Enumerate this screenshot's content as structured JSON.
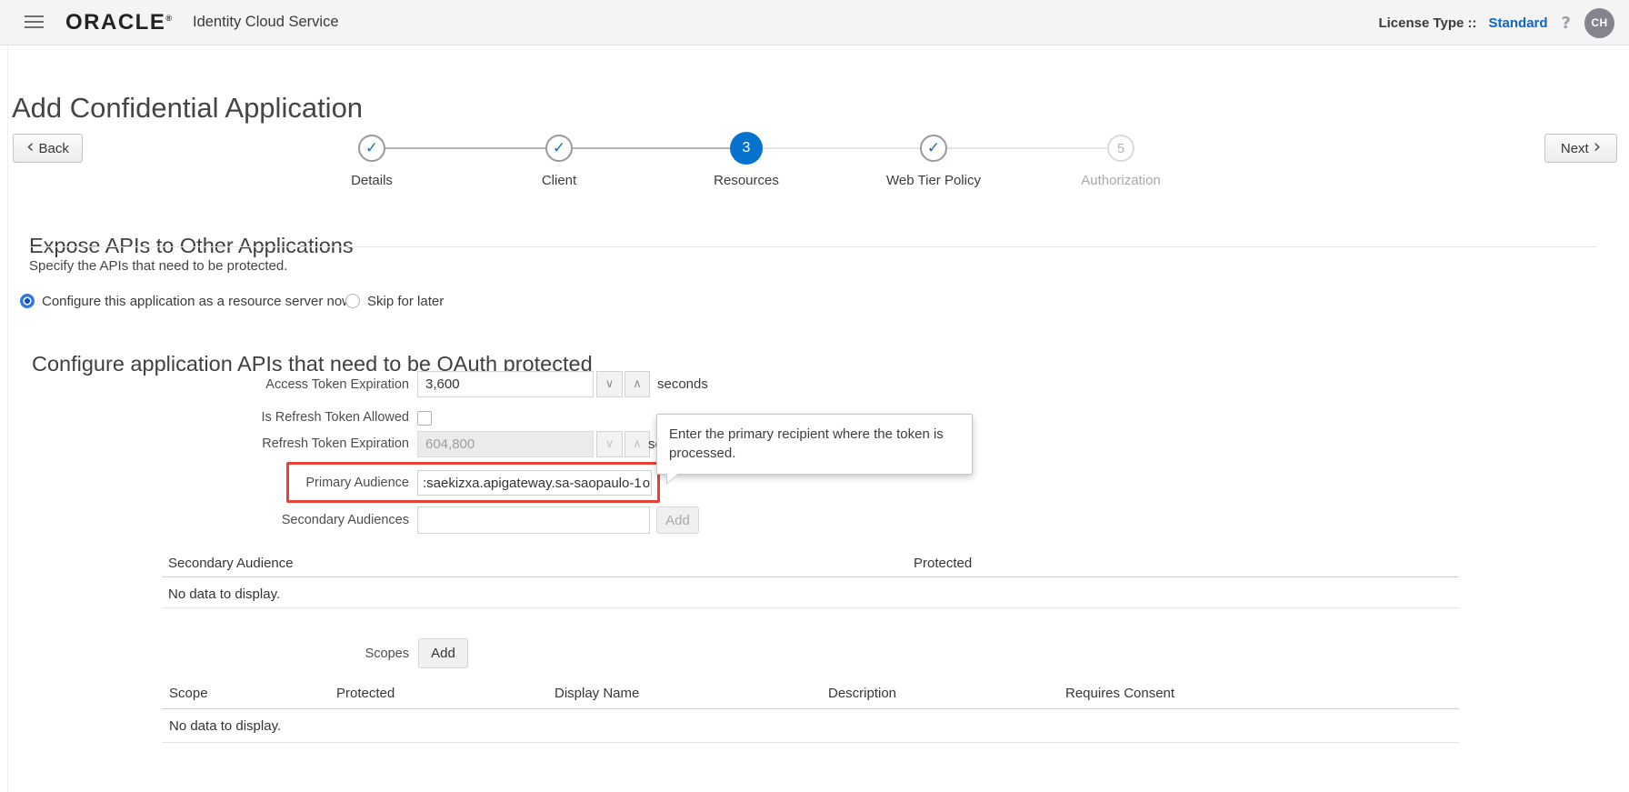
{
  "header": {
    "brand": "ORACLE",
    "brand_mark": "®",
    "product": "Identity Cloud Service",
    "license_label": "License Type ::",
    "license_value": "Standard",
    "help_icon": "?",
    "avatar_initials": "CH"
  },
  "page": {
    "title": "Add Confidential Application"
  },
  "nav": {
    "back": "Back",
    "next": "Next"
  },
  "wizard": {
    "steps": [
      {
        "label": "Details",
        "state": "complete"
      },
      {
        "label": "Client",
        "state": "complete"
      },
      {
        "label": "Resources",
        "state": "current",
        "number": "3"
      },
      {
        "label": "Web Tier Policy",
        "state": "complete"
      },
      {
        "label": "Authorization",
        "state": "upcoming",
        "number": "5"
      }
    ]
  },
  "expose_section": {
    "heading": "Expose APIs to Other Applications",
    "description": "Specify the APIs that need to be protected.",
    "radio_configure_label": "Configure this application as a resource server now",
    "radio_configure_selected": true,
    "radio_skip_label": "Skip for later",
    "radio_skip_selected": false
  },
  "oauth_section": {
    "heading": "Configure application APIs that need to be OAuth protected",
    "access_token_expiration": {
      "label": "Access Token Expiration",
      "value": "3,600",
      "unit": "seconds"
    },
    "is_refresh_token_allowed": {
      "label": "Is Refresh Token Allowed",
      "checked": false
    },
    "refresh_token_expiration": {
      "label": "Refresh Token Expiration",
      "value": "604,800",
      "unit": "seconds",
      "disabled": true
    },
    "primary_audience": {
      "label": "Primary Audience",
      "value_before_caret": ":saekizxa.apigateway.sa-saopaulo-1",
      "value_after_caret": "o",
      "highlighted": true
    },
    "secondary_audiences": {
      "label": "Secondary Audiences",
      "value": "",
      "add_button": "Add",
      "add_enabled": false
    },
    "tooltip": "Enter the primary recipient where the token is processed.",
    "scopes": {
      "label": "Scopes",
      "add_button": "Add"
    }
  },
  "secondary_audience_table": {
    "columns": [
      "Secondary Audience",
      "Protected"
    ],
    "empty_message": "No data to display."
  },
  "scopes_table": {
    "columns": [
      "Scope",
      "Protected",
      "Display Name",
      "Description",
      "Requires Consent"
    ],
    "empty_message": "No data to display."
  },
  "icons": {
    "check": "✓",
    "chevron_down": "∨",
    "chevron_up": "∧",
    "back_chevron": "‹",
    "next_chevron": "›"
  },
  "colors": {
    "accent_blue": "#0572ce",
    "highlight_red": "#e9403a",
    "topbar_bg": "#f4f4f4"
  }
}
